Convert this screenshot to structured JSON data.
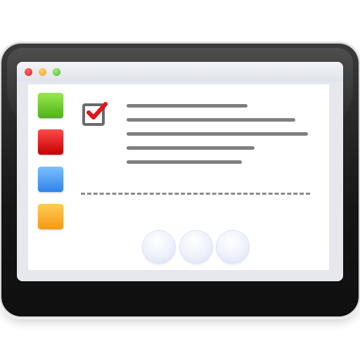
{
  "window": {
    "controls": [
      "close-dot",
      "minimize-dot",
      "maximize-dot"
    ],
    "control_colors": [
      "#e01b1b",
      "#f0a21a",
      "#43b81f"
    ]
  },
  "sidebar": {
    "tiles": [
      {
        "name": "green-tile",
        "color": "#4fb11a"
      },
      {
        "name": "red-tile",
        "color": "#c40000"
      },
      {
        "name": "blue-tile",
        "color": "#2f83ea"
      },
      {
        "name": "orange-tile",
        "color": "#f59a12"
      }
    ]
  },
  "task": {
    "checked": true,
    "check_icon": "checkmark-icon",
    "check_color": "#e0151b",
    "text_line_count": 5
  },
  "pagination": {
    "page_count": 3
  }
}
